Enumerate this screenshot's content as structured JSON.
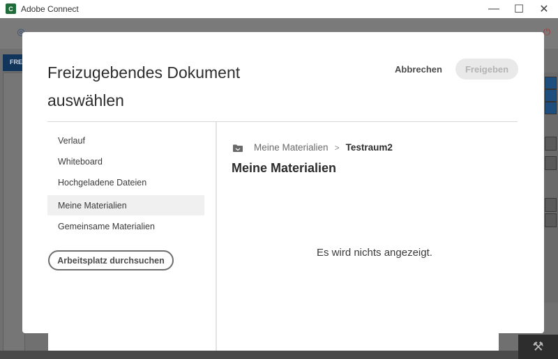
{
  "window": {
    "title": "Adobe Connect",
    "logo_letter": "C",
    "minimize_glyph": "—",
    "maximize_glyph": "☐",
    "close_glyph": "✕"
  },
  "background": {
    "pod_label": "FRE"
  },
  "modal": {
    "title": "Freizugebendes Dokument auswählen",
    "cancel_label": "Abbrechen",
    "share_label": "Freigeben",
    "share_enabled": false,
    "sidebar": {
      "items": [
        {
          "label": "Verlauf",
          "selected": false
        },
        {
          "label": "Whiteboard",
          "selected": false
        },
        {
          "label": "Hochgeladene Dateien",
          "selected": false
        },
        {
          "label": "Meine Materialien",
          "selected": true
        },
        {
          "label": "Gemeinsame Materialien",
          "selected": false
        }
      ],
      "browse_label": "Arbeitsplatz durchsuchen"
    },
    "breadcrumb": {
      "icon": "folder-icon",
      "parent": "Meine Materialien",
      "separator": ">",
      "current": "Testraum2"
    },
    "content_title": "Meine Materialien",
    "empty_message": "Es wird nichts angezeigt."
  },
  "colors": {
    "share_disabled_bg": "#e9e9e9",
    "share_disabled_text": "#b3b3b3",
    "selected_row_bg": "#f0f0f0"
  }
}
